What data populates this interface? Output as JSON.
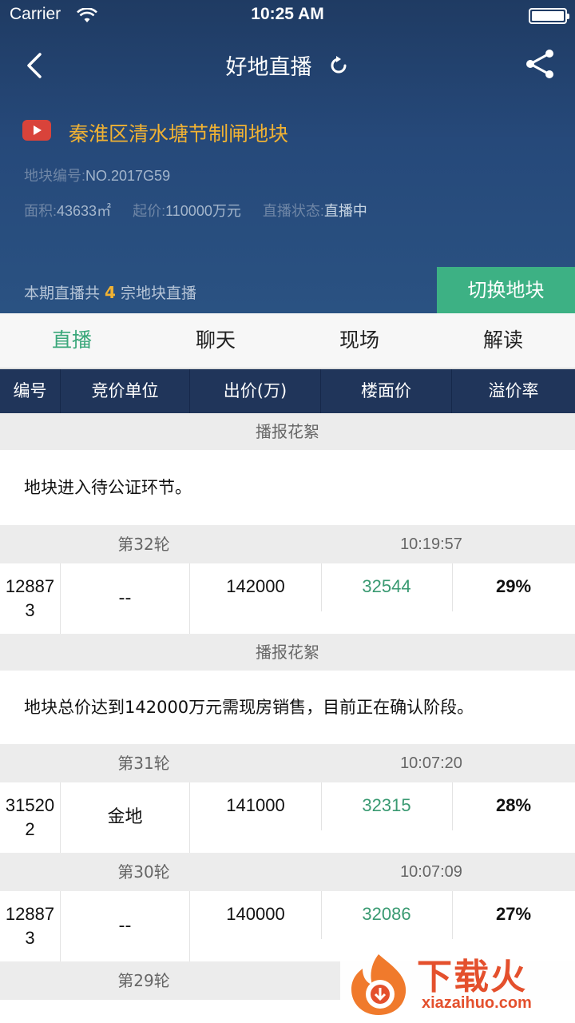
{
  "status_bar": {
    "carrier": "Carrier",
    "time": "10:25 AM"
  },
  "nav": {
    "title": "好地直播"
  },
  "land": {
    "name": "秦淮区清水塘节制闸地块",
    "code_label": "地块编号:",
    "code_value": "NO.2017G59",
    "area_label": "面积:",
    "area_value": "43633㎡",
    "start_price_label": "起价:",
    "start_price_value": "110000万元",
    "status_label": "直播状态:",
    "status_value": "直播中"
  },
  "period": {
    "prefix": "本期直播共",
    "count": "4",
    "suffix": "宗地块直播"
  },
  "switch_button": "切换地块",
  "tabs": [
    {
      "label": "直播"
    },
    {
      "label": "聊天"
    },
    {
      "label": "现场"
    },
    {
      "label": "解读"
    }
  ],
  "columns": [
    "编号",
    "竞价单位",
    "出价(万)",
    "楼面价",
    "溢价率"
  ],
  "feed": {
    "section_title": "播报花絮",
    "notice1": "地块进入待公证环节。",
    "notice2": "地块总价达到142000万元需现房销售，目前正在确认阶段。",
    "rounds": [
      {
        "round": "第32轮",
        "time": "10:19:57",
        "id_line1": "12887",
        "id_line2": "3",
        "unit": "--",
        "price": "142000",
        "floor": "32544",
        "rate": "29%"
      },
      {
        "round": "第31轮",
        "time": "10:07:20",
        "id_line1": "31520",
        "id_line2": "2",
        "unit": "金地",
        "price": "141000",
        "floor": "32315",
        "rate": "28%"
      },
      {
        "round": "第30轮",
        "time": "10:07:09",
        "id_line1": "12887",
        "id_line2": "3",
        "unit": "--",
        "price": "140000",
        "floor": "32086",
        "rate": "27%"
      },
      {
        "round": "第29轮"
      }
    ]
  },
  "watermark": {
    "text": "下载火",
    "url": "xiazaihuo.com"
  },
  "colors": {
    "accent_green": "#3db184",
    "header_blue": "#26497a",
    "gold": "#f1b233"
  }
}
